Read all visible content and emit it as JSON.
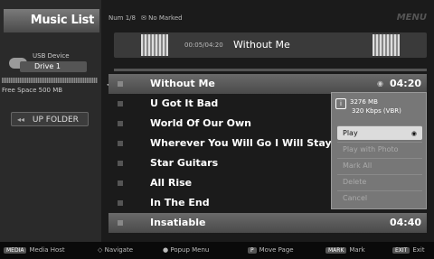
{
  "sidebar": {
    "title": "Music List",
    "device_label": "USB Device",
    "device_name": "Drive 1",
    "free_space": "Free Space 500 MB",
    "up_folder": "UP FOLDER"
  },
  "topbar": {
    "page": "Num 1/8",
    "marked": "No Marked",
    "brand": "MENU"
  },
  "now_playing": {
    "time": "00:05/04:20",
    "title": "Without Me"
  },
  "playlist": [
    {
      "title": "Without Me",
      "duration": "04:20",
      "selected": true
    },
    {
      "title": "U Got It Bad",
      "duration": ""
    },
    {
      "title": "World Of Our Own",
      "duration": ""
    },
    {
      "title": "Wherever You Will Go I Will Stay With",
      "duration": ""
    },
    {
      "title": "Star Guitars",
      "duration": ""
    },
    {
      "title": "All Rise",
      "duration": ""
    },
    {
      "title": "In The End",
      "duration": ""
    },
    {
      "title": "Insatiable",
      "duration": "04:40",
      "selected": true
    }
  ],
  "popup": {
    "size": "3276 MB",
    "bitrate": "320 Kbps (VBR)",
    "items": [
      "Play",
      "Play with Photo",
      "Mark All",
      "Delete",
      "Cancel"
    ]
  },
  "hints": {
    "media_host": "Media Host",
    "navigate": "Navigate",
    "popup_menu": "Popup Menu",
    "move_page": "Move Page",
    "mark": "Mark",
    "exit": "Exit"
  }
}
